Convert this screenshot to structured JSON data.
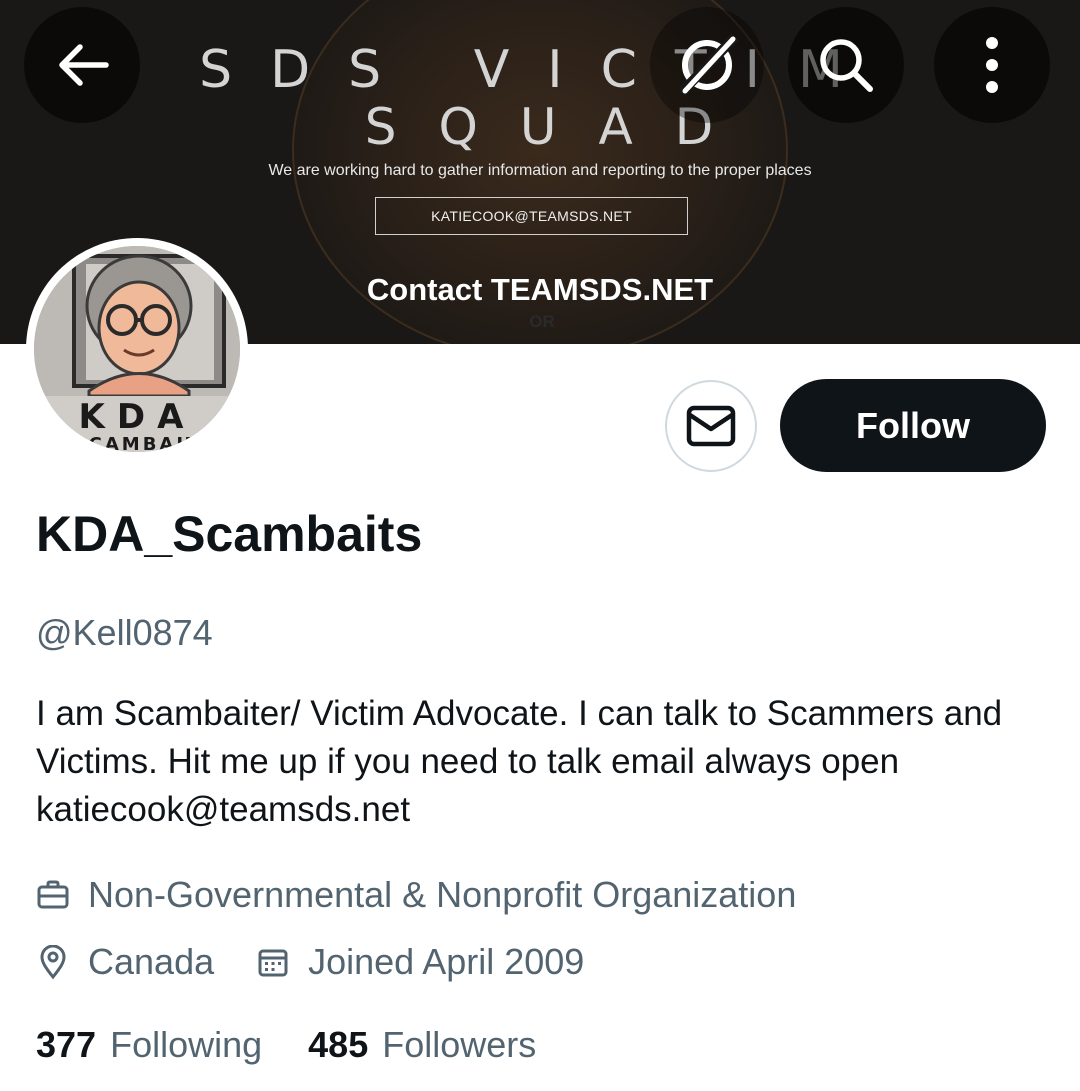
{
  "banner": {
    "title_line1": "SDS VICTIM",
    "title_line2": "SQUAD",
    "tagline": "We are working hard to gather information and reporting to the proper places",
    "email_box": "KATIECOOK@TEAMSDS.NET",
    "contact": "Contact TEAMSDS.NET",
    "or_text": "OR"
  },
  "avatar": {
    "caption_line1": "KDA",
    "caption_line2": "SCAMBAIT"
  },
  "actions": {
    "follow_label": "Follow"
  },
  "profile": {
    "display_name": "KDA_Scambaits",
    "handle": "@Kell0874",
    "bio": "I am Scambaiter/ Victim Advocate. I can talk to Scammers and Victims. Hit me up if you need to talk email always open katiecook@teamsds.net",
    "category": "Non-Governmental & Nonprofit Organization",
    "location": "Canada",
    "joined": "Joined April 2009"
  },
  "stats": {
    "following_count": "377",
    "following_label": "Following",
    "followers_count": "485",
    "followers_label": "Followers"
  },
  "icons": {
    "back": "arrow-left-icon",
    "grok": "grok-icon",
    "search": "search-icon",
    "more": "more-vertical-icon",
    "message": "envelope-icon",
    "category": "briefcase-icon",
    "location": "location-pin-icon",
    "joined": "calendar-icon"
  },
  "colors": {
    "primary_text": "#0f1419",
    "secondary_text": "#536471",
    "follow_button_bg": "#0f1419",
    "border": "#cfd9de"
  }
}
